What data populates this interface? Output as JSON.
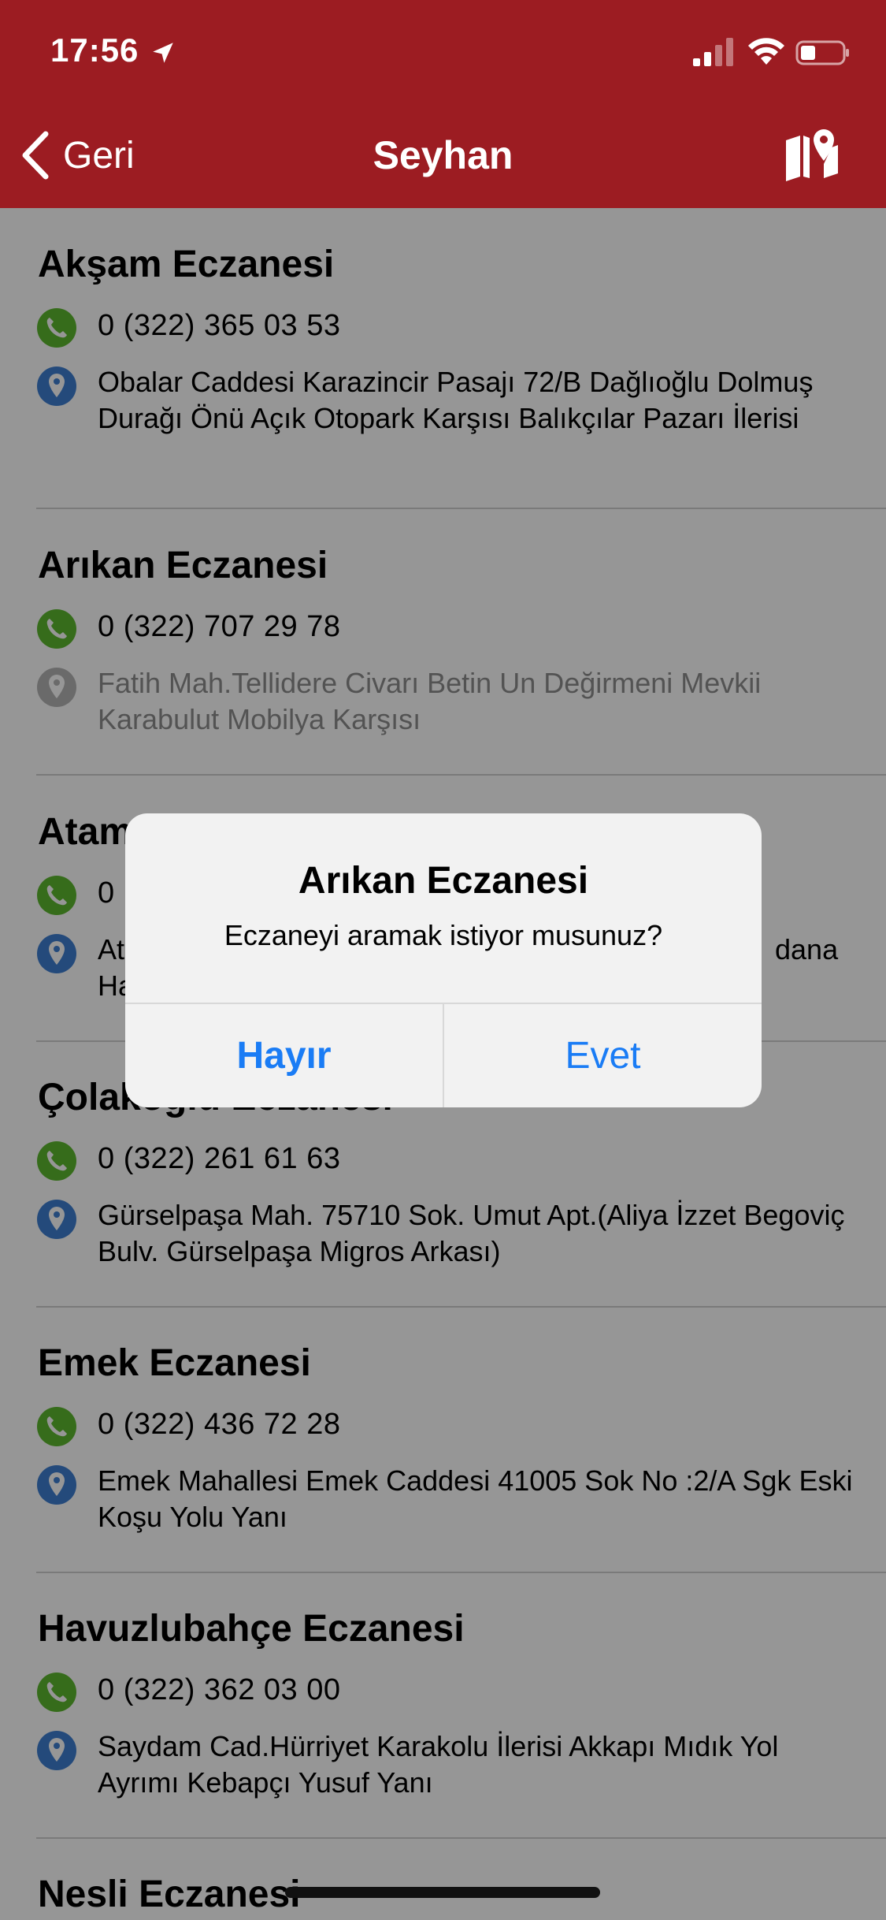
{
  "status_bar": {
    "time": "17:56"
  },
  "nav": {
    "back_label": "Geri",
    "title": "Seyhan"
  },
  "pharmacies": [
    {
      "name": "Akşam Eczanesi",
      "phone": "0 (322) 365 03 53",
      "address": "Obalar Caddesi Karazincir Pasajı 72/B Dağlıoğlu Dolmuş Durağı Önü Açık Otopark Karşısı Balıkçılar Pazarı İlerisi"
    },
    {
      "name": "Arıkan Eczanesi",
      "phone": "0 (322) 707 29 78",
      "address": "Fatih Mah.Tellidere Civarı Betin Un Değirmeni Mevkii Karabulut Mobilya Karşısı"
    },
    {
      "name": "Atam",
      "phone": "0",
      "address_line1_left": "At",
      "address_line1_right": "dana",
      "address_line2_left": "Ha"
    },
    {
      "name": "Çolakoğlu Eczanesi",
      "phone": "0 (322) 261 61 63",
      "address": "Gürselpaşa Mah. 75710 Sok. Umut Apt.(Aliya İzzet Begoviç Bulv. Gürselpaşa Migros Arkası)"
    },
    {
      "name": "Emek Eczanesi",
      "phone": "0 (322) 436 72 28",
      "address": "Emek Mahallesi Emek Caddesi 41005 Sok No :2/A Sgk  Eski Koşu Yolu Yanı"
    },
    {
      "name": "Havuzlubahçe Eczanesi",
      "phone": "0 (322) 362 03 00",
      "address": "Saydam Cad.Hürriyet Karakolu İlerisi Akkapı Mıdık Yol Ayrımı Kebapçı Yusuf Yanı"
    },
    {
      "name": "Nesli Eczanesi"
    }
  ],
  "alert": {
    "title": "Arıkan Eczanesi",
    "message": "Eczaneyi aramak istiyor musunuz?",
    "cancel_label": "Hayır",
    "confirm_label": "Evet"
  },
  "icons": {
    "phone": "phone-icon",
    "location": "location-pin-icon",
    "map": "map-icon",
    "back": "chevron-left-icon"
  },
  "colors": {
    "header": "#9c1c22",
    "phone_icon": "#5cb82f",
    "location_icon": "#3e7fd1",
    "location_icon_muted": "#b5b5b5",
    "alert_button": "#1a7cf5"
  }
}
